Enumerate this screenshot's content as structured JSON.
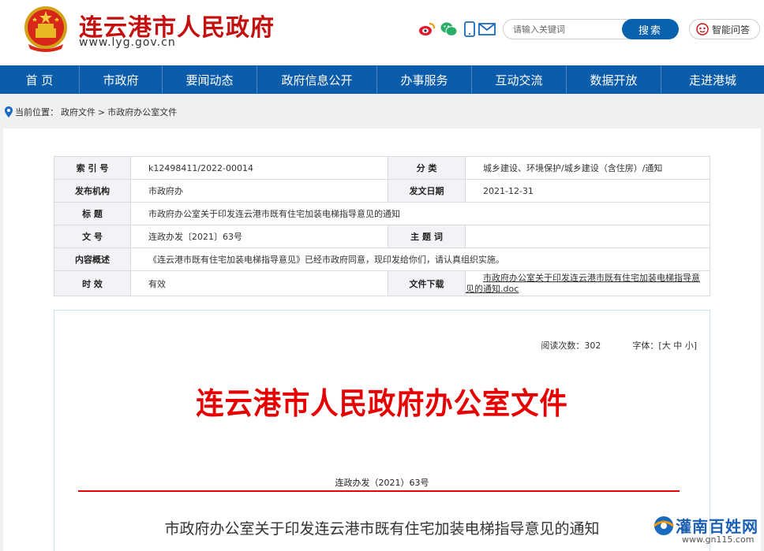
{
  "header": {
    "site_title": "连云港市人民政府",
    "site_url": "www.lyg.gov.cn",
    "search_placeholder": "请输入关键词",
    "search_button": "搜索",
    "qa_button": "智能问答"
  },
  "nav": {
    "items": [
      {
        "label": "首 页"
      },
      {
        "label": "市政府"
      },
      {
        "label": "要闻动态"
      },
      {
        "label": "政府信息公开"
      },
      {
        "label": "办事服务"
      },
      {
        "label": "互动交流"
      },
      {
        "label": "数据开放"
      },
      {
        "label": "走进港城"
      }
    ]
  },
  "breadcrumb": {
    "prefix": "当前位置：",
    "items": [
      "政府文件",
      "市政府办公室文件"
    ],
    "separator": ">"
  },
  "meta": {
    "index_label": "索 引 号",
    "index_value": "k12498411/2022-00014",
    "category_label": "分 类",
    "category_value": "城乡建设、环境保护/城乡建设（含住房）/通知",
    "issuer_label": "发布机构",
    "issuer_value": "市政府办",
    "date_label": "发文日期",
    "date_value": "2021-12-31",
    "title_label": "标 题",
    "title_value": "市政府办公室关于印发连云港市既有住宅加装电梯指导意见的通知",
    "docno_label": "文 号",
    "docno_value": "连政办发〔2021〕63号",
    "keywords_label": "主 题 词",
    "keywords_value": "",
    "summary_label": "内容概述",
    "summary_value": "《连云港市既有住宅加装电梯指导意见》已经市政府同意，现印发给你们，请认真组织实施。",
    "validity_label": "时 效",
    "validity_value": "有效",
    "download_label": "文件下载",
    "download_line1": "市政府办公室关于印发连云港市既有住宅加装电梯指导意",
    "download_line2": "见的通知.doc"
  },
  "document": {
    "read_count": "阅读次数：302",
    "font_label": "字体：[",
    "font_large": "大",
    "font_medium": "中",
    "font_small": "小",
    "font_close": "]",
    "head": "连云港市人民政府办公室文件",
    "number": "连政办发（2021）63号",
    "title": "市政府办公室关于印发连云港市既有住宅加装电梯指导意见的通知"
  },
  "watermark": {
    "text": "灌南百姓网",
    "url": "www.gn115.com"
  },
  "colors": {
    "brand_red": "#c40f0f",
    "nav_blue": "#0b5cab",
    "doc_red": "#e60000"
  }
}
